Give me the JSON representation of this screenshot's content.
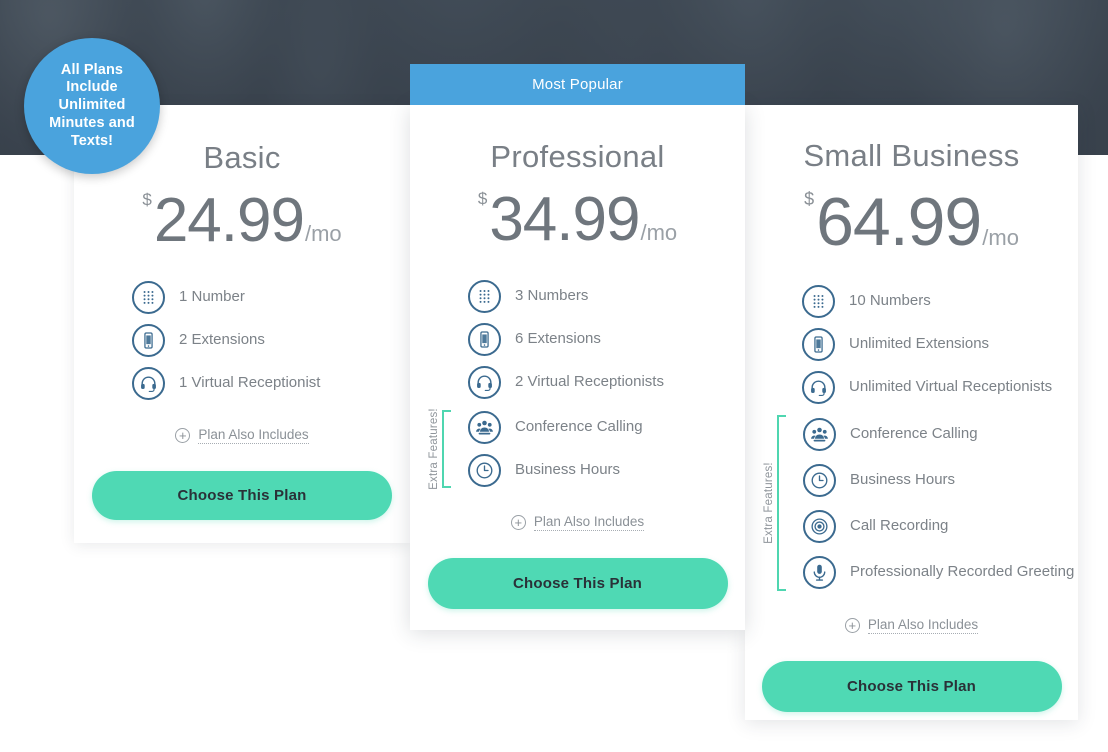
{
  "promo_badge": {
    "text": "All Plans\nInclude\nUnlimited\nMinutes and\nTexts!",
    "color": "#4aa3dd"
  },
  "popular_banner": {
    "label": "Most Popular",
    "color": "#4aa3dd"
  },
  "common": {
    "also_includes_label": "Plan Also Includes",
    "cta_label": "Choose This Plan",
    "extra_features_label": "Extra Features!",
    "currency_symbol": "$",
    "period_label": "/mo",
    "accent_teal": "#4fd9b4",
    "accent_blue": "#4aa3dd",
    "icon_blue": "#3b6a8f",
    "bracket_green": "#4fd6b0"
  },
  "plans": [
    {
      "id": "basic",
      "name": "Basic",
      "price": "24.99",
      "currency": "$",
      "period": "/mo",
      "features": [
        {
          "icon": "dialpad-icon",
          "label": "1 Number"
        },
        {
          "icon": "mobile-phone-icon",
          "label": "2 Extensions"
        },
        {
          "icon": "headset-icon",
          "label": "1 Virtual Receptionist"
        }
      ],
      "extra_features": [],
      "also_includes_label": "Plan Also Includes",
      "cta_label": "Choose This Plan"
    },
    {
      "id": "professional",
      "name": "Professional",
      "price": "34.99",
      "currency": "$",
      "period": "/mo",
      "badge": "Most Popular",
      "features": [
        {
          "icon": "dialpad-icon",
          "label": "3 Numbers"
        },
        {
          "icon": "mobile-phone-icon",
          "label": "6 Extensions"
        },
        {
          "icon": "headset-icon",
          "label": "2 Virtual Receptionists"
        }
      ],
      "extra_features": [
        {
          "icon": "conference-group-icon",
          "label": "Conference Calling"
        },
        {
          "icon": "clock-icon",
          "label": "Business Hours"
        }
      ],
      "extra_features_label": "Extra Features!",
      "also_includes_label": "Plan Also Includes",
      "cta_label": "Choose This Plan"
    },
    {
      "id": "small-business",
      "name": "Small Business",
      "price": "64.99",
      "currency": "$",
      "period": "/mo",
      "features": [
        {
          "icon": "dialpad-icon",
          "label": "10 Numbers"
        },
        {
          "icon": "mobile-phone-icon",
          "label": "Unlimited Extensions"
        },
        {
          "icon": "headset-icon",
          "label": "Unlimited Virtual Receptionists"
        }
      ],
      "extra_features": [
        {
          "icon": "conference-group-icon",
          "label": "Conference Calling"
        },
        {
          "icon": "clock-icon",
          "label": "Business Hours"
        },
        {
          "icon": "record-icon",
          "label": "Call Recording"
        },
        {
          "icon": "microphone-icon",
          "label": "Professionally Recorded Greeting"
        }
      ],
      "extra_features_label": "Extra Features!",
      "also_includes_label": "Plan Also Includes",
      "cta_label": "Choose This Plan"
    }
  ]
}
